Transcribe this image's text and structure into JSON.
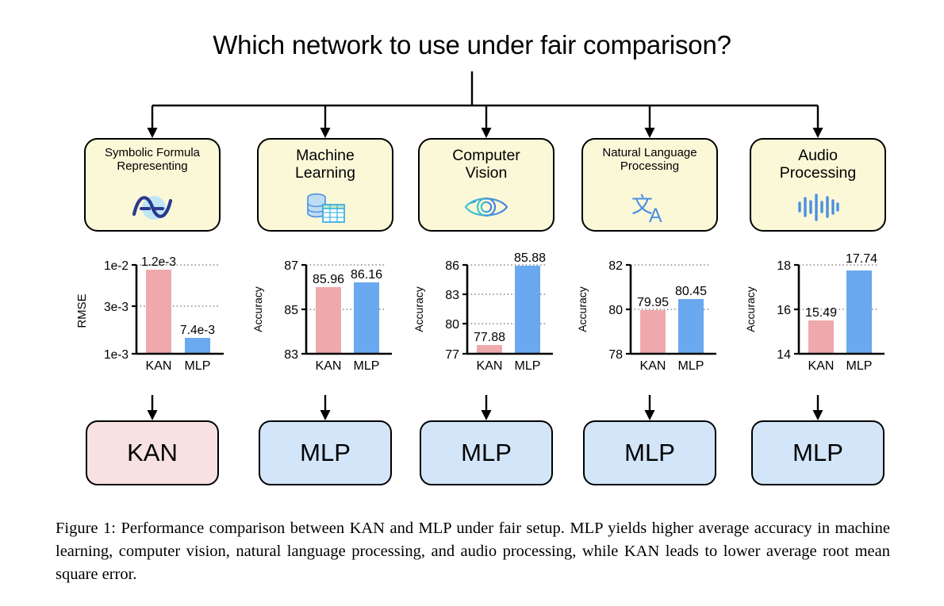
{
  "title": "Which network to use under fair comparison?",
  "caption": "Figure 1: Performance comparison between KAN and MLP under fair setup. MLP yields higher average accuracy in machine learning, computer vision, natural language processing, and audio processing, while KAN leads to lower average root mean square error.",
  "colors": {
    "kan_bar": "#efa9ac",
    "mlp_bar": "#6aa8ef",
    "task_box_fill": "#fbf8d8",
    "kan_result_fill": "#f7e2e1",
    "mlp_result_fill": "#d3e5f8",
    "border": "#000000",
    "icon_blue": "#4a90e2",
    "icon_navy": "#2b3a8f",
    "icon_teal": "#3fbfc4",
    "gridline": "#8a8a8a"
  },
  "columns": [
    {
      "task_label": "Symbolic Formula\nRepresenting",
      "task_label_size": "small",
      "icon": "sine-wave-icon",
      "result": "KAN",
      "result_type": "kan"
    },
    {
      "task_label": "Machine\nLearning",
      "task_label_size": "big",
      "icon": "database-table-icon",
      "result": "MLP",
      "result_type": "mlp"
    },
    {
      "task_label": "Computer\nVision",
      "task_label_size": "big",
      "icon": "eye-icon",
      "result": "MLP",
      "result_type": "mlp"
    },
    {
      "task_label": "Natural Language\nProcessing",
      "task_label_size": "small",
      "icon": "translate-icon",
      "result": "MLP",
      "result_type": "mlp"
    },
    {
      "task_label": "Audio\nProcessing",
      "task_label_size": "big",
      "icon": "audio-waveform-icon",
      "result": "MLP",
      "result_type": "mlp"
    }
  ],
  "chart_data": [
    {
      "type": "bar",
      "title": "Symbolic Formula Representing",
      "categories": [
        "KAN",
        "MLP"
      ],
      "values": [
        0.0012,
        0.0074
      ],
      "value_labels": [
        "1.2e-3",
        "7.4e-3"
      ],
      "series": [
        {
          "name": "RMSE",
          "values": [
            0.0012,
            0.0074
          ]
        }
      ],
      "ylabel": "RMSE",
      "xlabel": "",
      "tick_labels": [
        "1e-3",
        "3e-3",
        "1e-2"
      ],
      "tick_values": [
        0.001,
        0.003,
        0.01
      ],
      "ylim": [
        0.001,
        0.01
      ],
      "inverted_yaxis": true,
      "grid": true,
      "legend": "none",
      "bar_colors": [
        "#efa9ac",
        "#6aa8ef"
      ]
    },
    {
      "type": "bar",
      "title": "Machine Learning",
      "categories": [
        "KAN",
        "MLP"
      ],
      "values": [
        85.96,
        86.16
      ],
      "value_labels": [
        "85.96",
        "86.16"
      ],
      "series": [
        {
          "name": "Accuracy",
          "values": [
            85.96,
            86.16
          ]
        }
      ],
      "ylabel": "Accuracy",
      "xlabel": "",
      "tick_labels": [
        "83",
        "85",
        "87"
      ],
      "tick_values": [
        83,
        85,
        87
      ],
      "ylim": [
        83,
        87
      ],
      "inverted_yaxis": false,
      "grid": true,
      "legend": "none",
      "bar_colors": [
        "#efa9ac",
        "#6aa8ef"
      ]
    },
    {
      "type": "bar",
      "title": "Computer Vision",
      "categories": [
        "KAN",
        "MLP"
      ],
      "values": [
        77.88,
        85.88
      ],
      "value_labels": [
        "77.88",
        "85.88"
      ],
      "series": [
        {
          "name": "Accuracy",
          "values": [
            77.88,
            85.88
          ]
        }
      ],
      "ylabel": "Accuracy",
      "xlabel": "",
      "tick_labels": [
        "77",
        "80",
        "83",
        "86"
      ],
      "tick_values": [
        77,
        80,
        83,
        86
      ],
      "ylim": [
        77,
        86
      ],
      "inverted_yaxis": false,
      "grid": true,
      "legend": "none",
      "bar_colors": [
        "#efa9ac",
        "#6aa8ef"
      ]
    },
    {
      "type": "bar",
      "title": "Natural Language Processing",
      "categories": [
        "KAN",
        "MLP"
      ],
      "values": [
        79.95,
        80.45
      ],
      "value_labels": [
        "79.95",
        "80.45"
      ],
      "series": [
        {
          "name": "Accuracy",
          "values": [
            79.95,
            80.45
          ]
        }
      ],
      "ylabel": "Accuracy",
      "xlabel": "",
      "tick_labels": [
        "78",
        "80",
        "82"
      ],
      "tick_values": [
        78,
        80,
        82
      ],
      "ylim": [
        78,
        82
      ],
      "inverted_yaxis": false,
      "grid": true,
      "legend": "none",
      "bar_colors": [
        "#efa9ac",
        "#6aa8ef"
      ]
    },
    {
      "type": "bar",
      "title": "Audio Processing",
      "categories": [
        "KAN",
        "MLP"
      ],
      "values": [
        15.49,
        17.74
      ],
      "value_labels": [
        "15.49",
        "17.74"
      ],
      "series": [
        {
          "name": "Accuracy",
          "values": [
            15.49,
            17.74
          ]
        }
      ],
      "ylabel": "Accuracy",
      "xlabel": "",
      "tick_labels": [
        "14",
        "16",
        "18"
      ],
      "tick_values": [
        14,
        16,
        18
      ],
      "ylim": [
        14,
        18
      ],
      "inverted_yaxis": false,
      "grid": true,
      "legend": "none",
      "bar_colors": [
        "#efa9ac",
        "#6aa8ef"
      ]
    }
  ]
}
